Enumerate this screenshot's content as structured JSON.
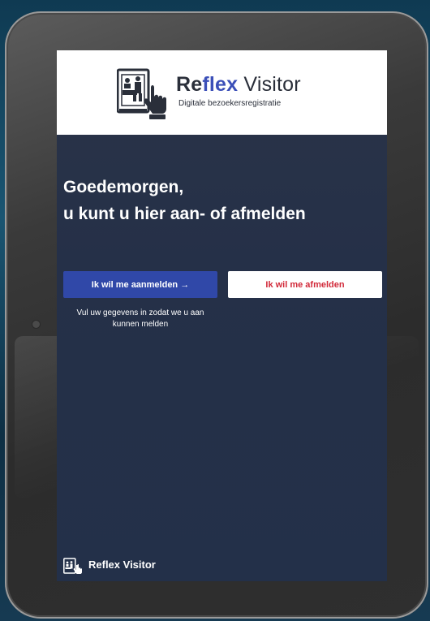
{
  "header": {
    "brand": {
      "part1": "Re",
      "part2": "flex",
      "part3": " Visitor"
    },
    "subtitle": "Digitale bezoekersregistratie",
    "logo_icon": "reception-kiosk-icon"
  },
  "main": {
    "greeting_line1": "Goedemorgen,",
    "greeting_line2": "u kunt u hier aan- of afmelden",
    "checkin_button": "Ik wil me aanmelden →",
    "checkout_button": "Ik wil me afmelden",
    "checkin_hint": "Vul uw gegevens in zodat we u aan kunnen melden"
  },
  "footer": {
    "brand": "Reflex Visitor",
    "logo_icon": "reception-kiosk-icon"
  },
  "colors": {
    "accent": "#3048a8",
    "danger": "#d22a3a",
    "screen_bg": "#253048"
  }
}
